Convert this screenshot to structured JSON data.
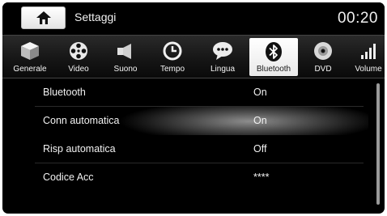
{
  "header": {
    "title": "Settaggi",
    "clock": "00:20"
  },
  "tabs": [
    {
      "label": "Generale",
      "icon": "cube-icon"
    },
    {
      "label": "Video",
      "icon": "film-reel-icon"
    },
    {
      "label": "Suono",
      "icon": "speaker-icon"
    },
    {
      "label": "Tempo",
      "icon": "clock-icon"
    },
    {
      "label": "Lingua",
      "icon": "speech-bubble-icon"
    },
    {
      "label": "Bluetooth",
      "icon": "bluetooth-icon",
      "active": true
    },
    {
      "label": "DVD",
      "icon": "disc-icon"
    },
    {
      "label": "Volume",
      "icon": "volume-bars-icon"
    }
  ],
  "settings": [
    {
      "name": "Bluetooth",
      "value": "On"
    },
    {
      "name": "Conn automatica",
      "value": "On"
    },
    {
      "name": "Risp automatica",
      "value": "Off"
    },
    {
      "name": "Codice Acc",
      "value": "****"
    }
  ]
}
